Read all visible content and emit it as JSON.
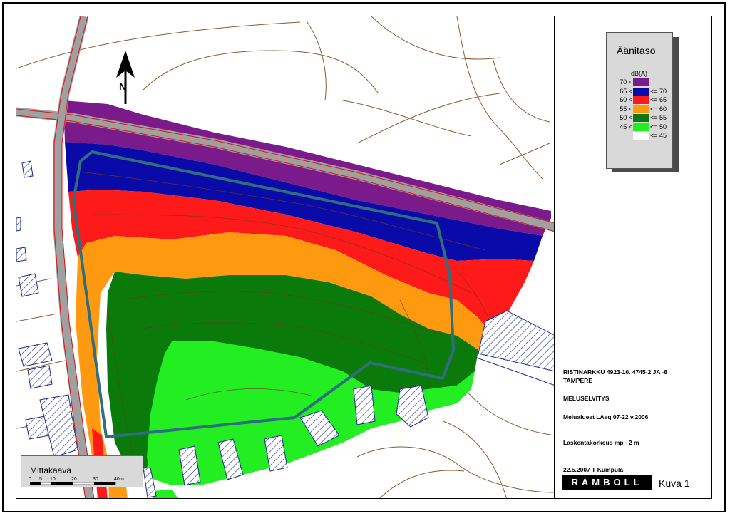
{
  "legend": {
    "title": "Äänitaso",
    "unit": "dB(A)",
    "rows": [
      {
        "low": "70 <",
        "high": "",
        "color": "#7b1a8a"
      },
      {
        "low": "65 <",
        "high": "<= 70",
        "color": "#0a0aa8"
      },
      {
        "low": "60 <",
        "high": "<= 65",
        "color": "#ff1a1a"
      },
      {
        "low": "55 <",
        "high": "<= 60",
        "color": "#ff9a10"
      },
      {
        "low": "50 <",
        "high": "<= 55",
        "color": "#0a7a0a"
      },
      {
        "low": "45 <",
        "high": "<= 50",
        "color": "#22ee22"
      },
      {
        "low": "",
        "high": "<= 45",
        "color": "#ffffff"
      }
    ]
  },
  "info": {
    "project": "RISTINARKKU 4923-10. 4745-2 JA -8",
    "city": "TAMPERE",
    "report": "MELUSELVITYS",
    "description": "Melualueet LAeq 07-22 v.2006",
    "height": "Laskentakorkeus mp +2 m",
    "author": "22.5.2007 T Kumpula",
    "company": "RAMBOLL",
    "figure": "Kuva 1"
  },
  "scalebar": {
    "title": "Mittakaava",
    "ticks": [
      "0",
      "5",
      "10",
      "20",
      "30",
      "40"
    ],
    "unit": "m"
  },
  "north_arrow": {
    "label": "N"
  },
  "colors": {
    "road": "#a0a0a0",
    "road_centerline": "#d11",
    "contour_lines": "#8b5a2b",
    "boundary": "#2e6e7e",
    "hatch": "#1a2a8a"
  }
}
